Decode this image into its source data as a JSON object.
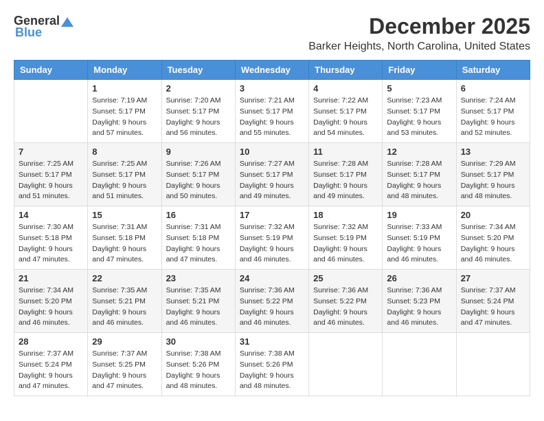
{
  "header": {
    "logo_general": "General",
    "logo_blue": "Blue",
    "month": "December 2025",
    "location": "Barker Heights, North Carolina, United States"
  },
  "weekdays": [
    "Sunday",
    "Monday",
    "Tuesday",
    "Wednesday",
    "Thursday",
    "Friday",
    "Saturday"
  ],
  "weeks": [
    [
      {
        "day": "",
        "sunrise": "",
        "sunset": "",
        "daylight": ""
      },
      {
        "day": "1",
        "sunrise": "Sunrise: 7:19 AM",
        "sunset": "Sunset: 5:17 PM",
        "daylight": "Daylight: 9 hours and 57 minutes."
      },
      {
        "day": "2",
        "sunrise": "Sunrise: 7:20 AM",
        "sunset": "Sunset: 5:17 PM",
        "daylight": "Daylight: 9 hours and 56 minutes."
      },
      {
        "day": "3",
        "sunrise": "Sunrise: 7:21 AM",
        "sunset": "Sunset: 5:17 PM",
        "daylight": "Daylight: 9 hours and 55 minutes."
      },
      {
        "day": "4",
        "sunrise": "Sunrise: 7:22 AM",
        "sunset": "Sunset: 5:17 PM",
        "daylight": "Daylight: 9 hours and 54 minutes."
      },
      {
        "day": "5",
        "sunrise": "Sunrise: 7:23 AM",
        "sunset": "Sunset: 5:17 PM",
        "daylight": "Daylight: 9 hours and 53 minutes."
      },
      {
        "day": "6",
        "sunrise": "Sunrise: 7:24 AM",
        "sunset": "Sunset: 5:17 PM",
        "daylight": "Daylight: 9 hours and 52 minutes."
      }
    ],
    [
      {
        "day": "7",
        "sunrise": "Sunrise: 7:25 AM",
        "sunset": "Sunset: 5:17 PM",
        "daylight": "Daylight: 9 hours and 51 minutes."
      },
      {
        "day": "8",
        "sunrise": "Sunrise: 7:25 AM",
        "sunset": "Sunset: 5:17 PM",
        "daylight": "Daylight: 9 hours and 51 minutes."
      },
      {
        "day": "9",
        "sunrise": "Sunrise: 7:26 AM",
        "sunset": "Sunset: 5:17 PM",
        "daylight": "Daylight: 9 hours and 50 minutes."
      },
      {
        "day": "10",
        "sunrise": "Sunrise: 7:27 AM",
        "sunset": "Sunset: 5:17 PM",
        "daylight": "Daylight: 9 hours and 49 minutes."
      },
      {
        "day": "11",
        "sunrise": "Sunrise: 7:28 AM",
        "sunset": "Sunset: 5:17 PM",
        "daylight": "Daylight: 9 hours and 49 minutes."
      },
      {
        "day": "12",
        "sunrise": "Sunrise: 7:28 AM",
        "sunset": "Sunset: 5:17 PM",
        "daylight": "Daylight: 9 hours and 48 minutes."
      },
      {
        "day": "13",
        "sunrise": "Sunrise: 7:29 AM",
        "sunset": "Sunset: 5:17 PM",
        "daylight": "Daylight: 9 hours and 48 minutes."
      }
    ],
    [
      {
        "day": "14",
        "sunrise": "Sunrise: 7:30 AM",
        "sunset": "Sunset: 5:18 PM",
        "daylight": "Daylight: 9 hours and 47 minutes."
      },
      {
        "day": "15",
        "sunrise": "Sunrise: 7:31 AM",
        "sunset": "Sunset: 5:18 PM",
        "daylight": "Daylight: 9 hours and 47 minutes."
      },
      {
        "day": "16",
        "sunrise": "Sunrise: 7:31 AM",
        "sunset": "Sunset: 5:18 PM",
        "daylight": "Daylight: 9 hours and 47 minutes."
      },
      {
        "day": "17",
        "sunrise": "Sunrise: 7:32 AM",
        "sunset": "Sunset: 5:19 PM",
        "daylight": "Daylight: 9 hours and 46 minutes."
      },
      {
        "day": "18",
        "sunrise": "Sunrise: 7:32 AM",
        "sunset": "Sunset: 5:19 PM",
        "daylight": "Daylight: 9 hours and 46 minutes."
      },
      {
        "day": "19",
        "sunrise": "Sunrise: 7:33 AM",
        "sunset": "Sunset: 5:19 PM",
        "daylight": "Daylight: 9 hours and 46 minutes."
      },
      {
        "day": "20",
        "sunrise": "Sunrise: 7:34 AM",
        "sunset": "Sunset: 5:20 PM",
        "daylight": "Daylight: 9 hours and 46 minutes."
      }
    ],
    [
      {
        "day": "21",
        "sunrise": "Sunrise: 7:34 AM",
        "sunset": "Sunset: 5:20 PM",
        "daylight": "Daylight: 9 hours and 46 minutes."
      },
      {
        "day": "22",
        "sunrise": "Sunrise: 7:35 AM",
        "sunset": "Sunset: 5:21 PM",
        "daylight": "Daylight: 9 hours and 46 minutes."
      },
      {
        "day": "23",
        "sunrise": "Sunrise: 7:35 AM",
        "sunset": "Sunset: 5:21 PM",
        "daylight": "Daylight: 9 hours and 46 minutes."
      },
      {
        "day": "24",
        "sunrise": "Sunrise: 7:36 AM",
        "sunset": "Sunset: 5:22 PM",
        "daylight": "Daylight: 9 hours and 46 minutes."
      },
      {
        "day": "25",
        "sunrise": "Sunrise: 7:36 AM",
        "sunset": "Sunset: 5:22 PM",
        "daylight": "Daylight: 9 hours and 46 minutes."
      },
      {
        "day": "26",
        "sunrise": "Sunrise: 7:36 AM",
        "sunset": "Sunset: 5:23 PM",
        "daylight": "Daylight: 9 hours and 46 minutes."
      },
      {
        "day": "27",
        "sunrise": "Sunrise: 7:37 AM",
        "sunset": "Sunset: 5:24 PM",
        "daylight": "Daylight: 9 hours and 47 minutes."
      }
    ],
    [
      {
        "day": "28",
        "sunrise": "Sunrise: 7:37 AM",
        "sunset": "Sunset: 5:24 PM",
        "daylight": "Daylight: 9 hours and 47 minutes."
      },
      {
        "day": "29",
        "sunrise": "Sunrise: 7:37 AM",
        "sunset": "Sunset: 5:25 PM",
        "daylight": "Daylight: 9 hours and 47 minutes."
      },
      {
        "day": "30",
        "sunrise": "Sunrise: 7:38 AM",
        "sunset": "Sunset: 5:26 PM",
        "daylight": "Daylight: 9 hours and 48 minutes."
      },
      {
        "day": "31",
        "sunrise": "Sunrise: 7:38 AM",
        "sunset": "Sunset: 5:26 PM",
        "daylight": "Daylight: 9 hours and 48 minutes."
      },
      {
        "day": "",
        "sunrise": "",
        "sunset": "",
        "daylight": ""
      },
      {
        "day": "",
        "sunrise": "",
        "sunset": "",
        "daylight": ""
      },
      {
        "day": "",
        "sunrise": "",
        "sunset": "",
        "daylight": ""
      }
    ]
  ]
}
